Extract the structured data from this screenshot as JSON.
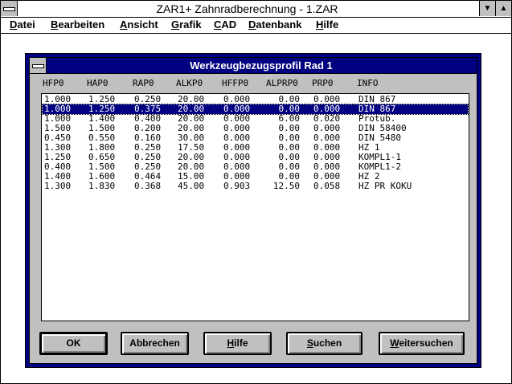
{
  "app": {
    "title": "ZAR1+  Zahnradberechnung  - 1.ZAR",
    "minimize_glyph": "▼",
    "maximize_glyph": "▲"
  },
  "menu": {
    "items": [
      {
        "label": "Datei"
      },
      {
        "label": "Bearbeiten"
      },
      {
        "label": "Ansicht"
      },
      {
        "label": "Grafik"
      },
      {
        "label": "CAD"
      },
      {
        "label": "Datenbank"
      },
      {
        "label": "Hilfe"
      }
    ]
  },
  "dialog": {
    "title": "Werkzeugbezugsprofil Rad 1",
    "columns": [
      "HFP0",
      "HAP0",
      "RAP0",
      "ALKP0",
      "HFFP0",
      "ALPRP0",
      "PRP0",
      "INFO"
    ],
    "selected_index": 1,
    "rows": [
      [
        "1.000",
        "1.250",
        "0.250",
        "20.00",
        "0.000",
        "0.00",
        "0.000",
        "DIN 867"
      ],
      [
        "1.000",
        "1.250",
        "0.375",
        "20.00",
        "0.000",
        "0.00",
        "0.000",
        "DIN 867"
      ],
      [
        "1.000",
        "1.400",
        "0.400",
        "20.00",
        "0.000",
        "6.00",
        "0.020",
        "Protub."
      ],
      [
        "1.500",
        "1.500",
        "0.200",
        "20.00",
        "0.000",
        "0.00",
        "0.000",
        "DIN 58400"
      ],
      [
        "0.450",
        "0.550",
        "0.160",
        "30.00",
        "0.000",
        "0.00",
        "0.000",
        "DIN 5480"
      ],
      [
        "1.300",
        "1.800",
        "0.250",
        "17.50",
        "0.000",
        "0.00",
        "0.000",
        "HZ 1"
      ],
      [
        "1.250",
        "0.650",
        "0.250",
        "20.00",
        "0.000",
        "0.00",
        "0.000",
        "KOMPL1-1"
      ],
      [
        "0.400",
        "1.500",
        "0.250",
        "20.00",
        "0.000",
        "0.00",
        "0.000",
        "KOMPL1-2"
      ],
      [
        "1.400",
        "1.600",
        "0.464",
        "15.00",
        "0.000",
        "0.00",
        "0.000",
        "HZ 2"
      ],
      [
        "1.300",
        "1.830",
        "0.368",
        "45.00",
        "0.903",
        "12.50",
        "0.058",
        "HZ PR KOKU"
      ]
    ],
    "buttons": {
      "ok": "OK",
      "cancel": "Abbrechen",
      "help": "Hilfe",
      "search": "Suchen",
      "search_next": "Weitersuchen"
    }
  }
}
